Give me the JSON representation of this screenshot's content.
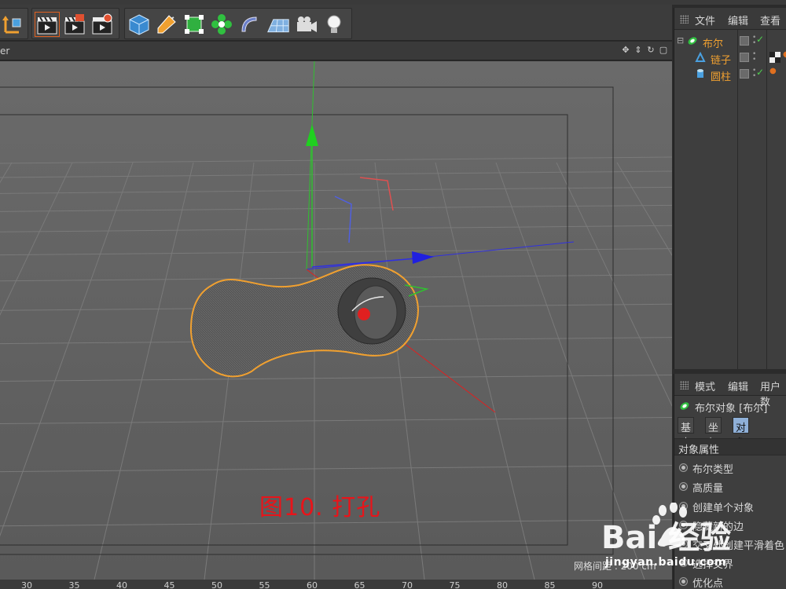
{
  "viewport": {
    "label": "er",
    "caption": "图10. 打孔",
    "grid_distance": "网格间距 : 200 cm"
  },
  "timeline_ruler": {
    "ticks": [
      "30",
      "35",
      "40",
      "45",
      "50",
      "55",
      "60",
      "65",
      "70",
      "75",
      "80",
      "85",
      "90"
    ]
  },
  "object_manager": {
    "tabs": [
      "文件",
      "编辑",
      "查看"
    ],
    "objects": [
      {
        "name": "布尔",
        "icon": "boole-icon",
        "checked": true
      },
      {
        "name": "链子",
        "icon": "sweep-icon",
        "checked": false
      },
      {
        "name": "圆柱",
        "icon": "cylinder-icon",
        "checked": true
      }
    ]
  },
  "attribute_manager": {
    "tabs": [
      "模式",
      "编辑",
      "用户数"
    ],
    "title": "布尔对象 [布尔]",
    "sub_tabs": [
      "基本",
      "坐标",
      "对象"
    ],
    "active_sub_tab": "对象",
    "section": "对象属性",
    "properties": [
      "布尔类型",
      "高质量",
      "创建单个对象",
      "隐藏新的边",
      "交叉处创建平滑着色",
      "选择交界",
      "优化点"
    ]
  },
  "watermark": {
    "brand": "Bai 经验",
    "url": "jingyan.baidu.com"
  },
  "colors": {
    "caption": "#e8141a",
    "selection_outline": "#f0a030",
    "axis_x": "#e02020",
    "axis_y": "#20c020",
    "axis_z": "#3030e0",
    "active_tab": "#8fb0d8"
  }
}
